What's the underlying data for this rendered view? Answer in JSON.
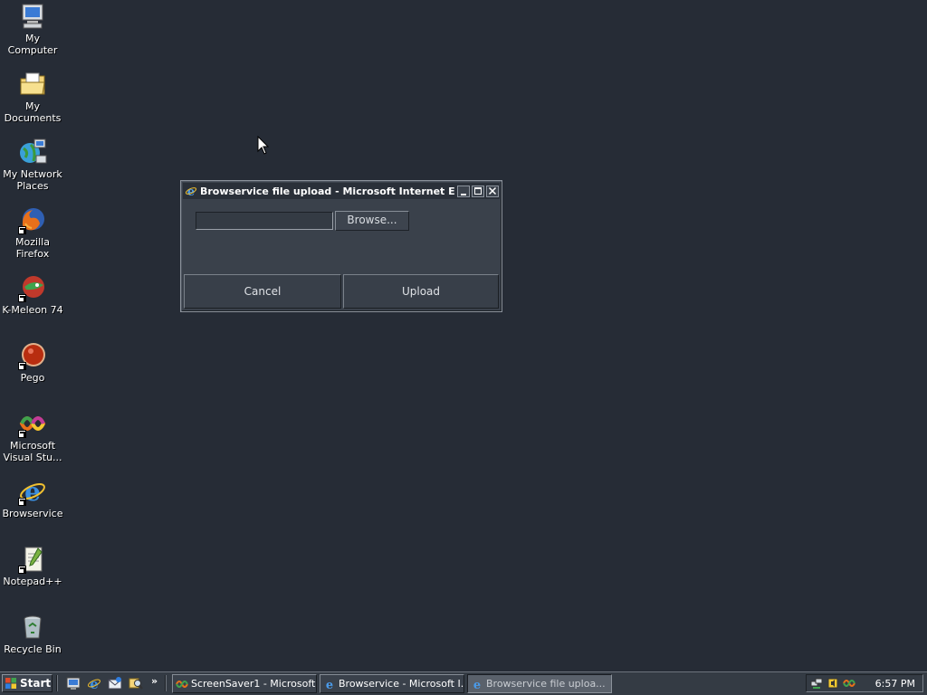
{
  "desktop": {
    "background_color": "#262c36",
    "icons": [
      {
        "label": "My Computer",
        "icon": "computer-icon"
      },
      {
        "label": "My Documents",
        "icon": "folder-documents-icon"
      },
      {
        "label": "My Network Places",
        "icon": "network-places-icon"
      },
      {
        "label": "Mozilla Firefox",
        "icon": "firefox-icon"
      },
      {
        "label": "K-Meleon 74",
        "icon": "k-meleon-icon"
      },
      {
        "label": "Pego",
        "icon": "pego-icon"
      },
      {
        "label": "Microsoft Visual Stu...",
        "icon": "visual-studio-icon"
      },
      {
        "label": "Browservice",
        "icon": "internet-explorer-icon"
      },
      {
        "label": "Notepad++",
        "icon": "notepad-plus-plus-icon"
      },
      {
        "label": "Recycle Bin",
        "icon": "recycle-bin-icon"
      }
    ]
  },
  "dialog": {
    "title": "Browservice file upload - Microsoft Internet Expl...",
    "file_path_value": "",
    "browse_label": "Browse...",
    "cancel_label": "Cancel",
    "upload_label": "Upload",
    "caption_buttons": [
      "minimize-icon",
      "maximize-icon",
      "close-icon"
    ]
  },
  "taskbar": {
    "start_label": "Start",
    "quick_launch_icons": [
      "show-desktop-icon",
      "internet-explorer-icon",
      "outlook-express-icon",
      "search-icon"
    ],
    "chevron": "»",
    "tasks": [
      {
        "label": "ScreenSaver1 - Microsoft ...",
        "icon": "visual-studio-icon",
        "active": false
      },
      {
        "label": "Browservice - Microsoft I...",
        "icon": "internet-explorer-icon",
        "active": false
      },
      {
        "label": "Browservice file uploa...",
        "icon": "internet-explorer-icon",
        "active": true
      }
    ],
    "tray_icons": [
      "network-icon",
      "sound-icon",
      "visual-studio-icon"
    ],
    "clock": "6:57 PM"
  }
}
